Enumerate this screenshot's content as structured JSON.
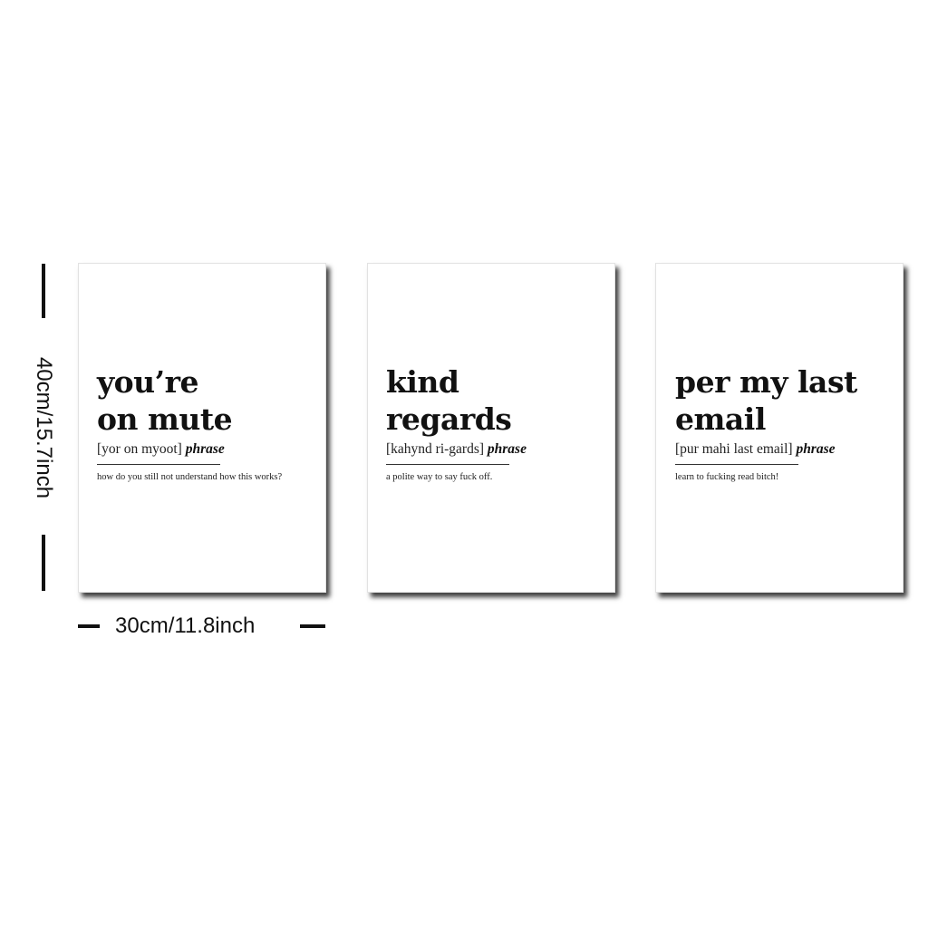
{
  "dimensions": {
    "height_label": "40cm/15.7inch",
    "width_label": "30cm/11.8inch"
  },
  "posters": [
    {
      "title_line1": "you’re",
      "title_line2": "on mute",
      "pronunciation": "[yor on myoot]",
      "part_of_speech": "phrase",
      "definition": "how do you still not understand how this works?"
    },
    {
      "title_line1": "kind",
      "title_line2": "regards",
      "pronunciation": "[kahynd ri-gards]",
      "part_of_speech": "phrase",
      "definition": "a polite way to say fuck off."
    },
    {
      "title_line1": "per my last",
      "title_line2": "email",
      "pronunciation": "[pur mahi last email]",
      "part_of_speech": "phrase",
      "definition": "learn to fucking read bitch!"
    }
  ]
}
